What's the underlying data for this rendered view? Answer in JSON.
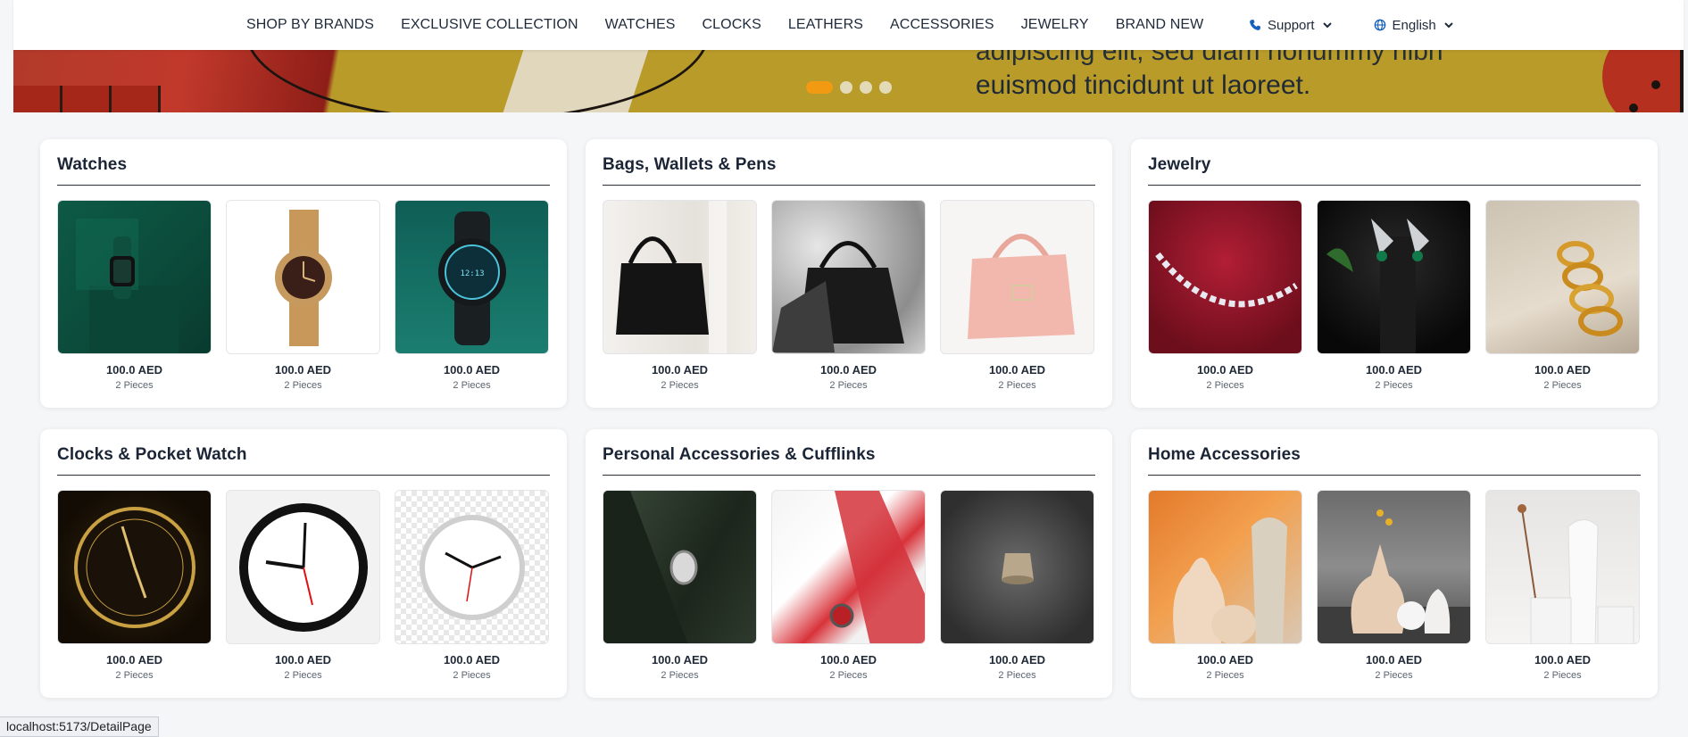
{
  "nav": {
    "items": [
      {
        "label": "SHOP BY BRANDS"
      },
      {
        "label": "EXCLUSIVE COLLECTION"
      },
      {
        "label": "WATCHES"
      },
      {
        "label": "CLOCKS"
      },
      {
        "label": "LEATHERS"
      },
      {
        "label": "ACCESSORIES"
      },
      {
        "label": "JEWELRY"
      },
      {
        "label": "BRAND NEW"
      }
    ],
    "support": {
      "label": "Support",
      "icon": "phone-icon"
    },
    "language": {
      "label": "English",
      "icon": "globe-icon"
    }
  },
  "hero": {
    "text_top": "adipiscing elit, sed diam nonummy nibh",
    "text_line": "euismod tincidunt ut laoreet.",
    "slides_count": 4,
    "active_slide": 1,
    "accent": "#f29a12"
  },
  "categories": [
    {
      "title": "Watches",
      "products": [
        {
          "price": "100.0 AED",
          "pieces": "2 Pieces"
        },
        {
          "price": "100.0 AED",
          "pieces": "2 Pieces"
        },
        {
          "price": "100.0 AED",
          "pieces": "2 Pieces"
        }
      ]
    },
    {
      "title": "Bags, Wallets & Pens",
      "products": [
        {
          "price": "100.0 AED",
          "pieces": "2 Pieces"
        },
        {
          "price": "100.0 AED",
          "pieces": "2 Pieces"
        },
        {
          "price": "100.0 AED",
          "pieces": "2 Pieces"
        }
      ]
    },
    {
      "title": "Jewelry",
      "products": [
        {
          "price": "100.0 AED",
          "pieces": "2 Pieces"
        },
        {
          "price": "100.0 AED",
          "pieces": "2 Pieces"
        },
        {
          "price": "100.0 AED",
          "pieces": "2 Pieces"
        }
      ]
    },
    {
      "title": "Clocks & Pocket Watch",
      "products": [
        {
          "price": "100.0 AED",
          "pieces": "2 Pieces"
        },
        {
          "price": "100.0 AED",
          "pieces": "2 Pieces"
        },
        {
          "price": "100.0 AED",
          "pieces": "2 Pieces"
        }
      ]
    },
    {
      "title": "Personal Accessories & Cufflinks",
      "products": [
        {
          "price": "100.0 AED",
          "pieces": "2 Pieces"
        },
        {
          "price": "100.0 AED",
          "pieces": "2 Pieces"
        },
        {
          "price": "100.0 AED",
          "pieces": "2 Pieces"
        }
      ]
    },
    {
      "title": "Home Accessories",
      "products": [
        {
          "price": "100.0 AED",
          "pieces": "2 Pieces"
        },
        {
          "price": "100.0 AED",
          "pieces": "2 Pieces"
        },
        {
          "price": "100.0 AED",
          "pieces": "2 Pieces"
        }
      ]
    }
  ],
  "status_bar": {
    "url": "localhost:5173/DetailPage"
  }
}
